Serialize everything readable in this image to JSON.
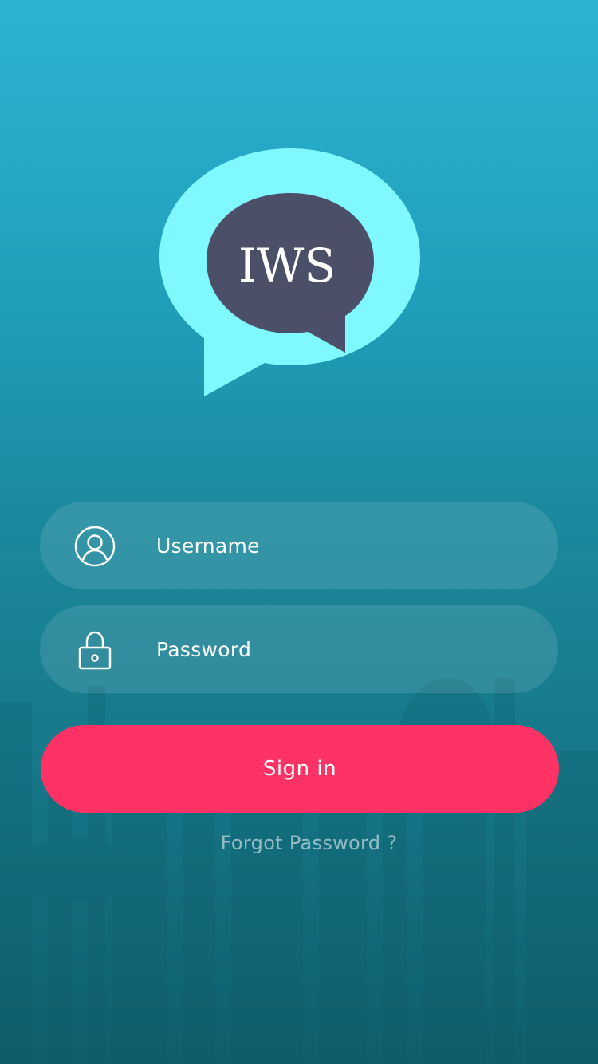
{
  "logo": {
    "text": "IWS",
    "bubble_outer_color": "#80f8ff",
    "bubble_inner_color": "#4b5068"
  },
  "login": {
    "username_placeholder": "Username",
    "password_placeholder": "Password",
    "username_icon": "user-circle-icon",
    "password_icon": "lock-icon",
    "signin_label": "Sign in",
    "forgot_label": "Forgot Password ?"
  },
  "colors": {
    "accent": "#fe3264",
    "background_top": "#2bb3d3",
    "background_bottom": "#0f5e6c"
  }
}
